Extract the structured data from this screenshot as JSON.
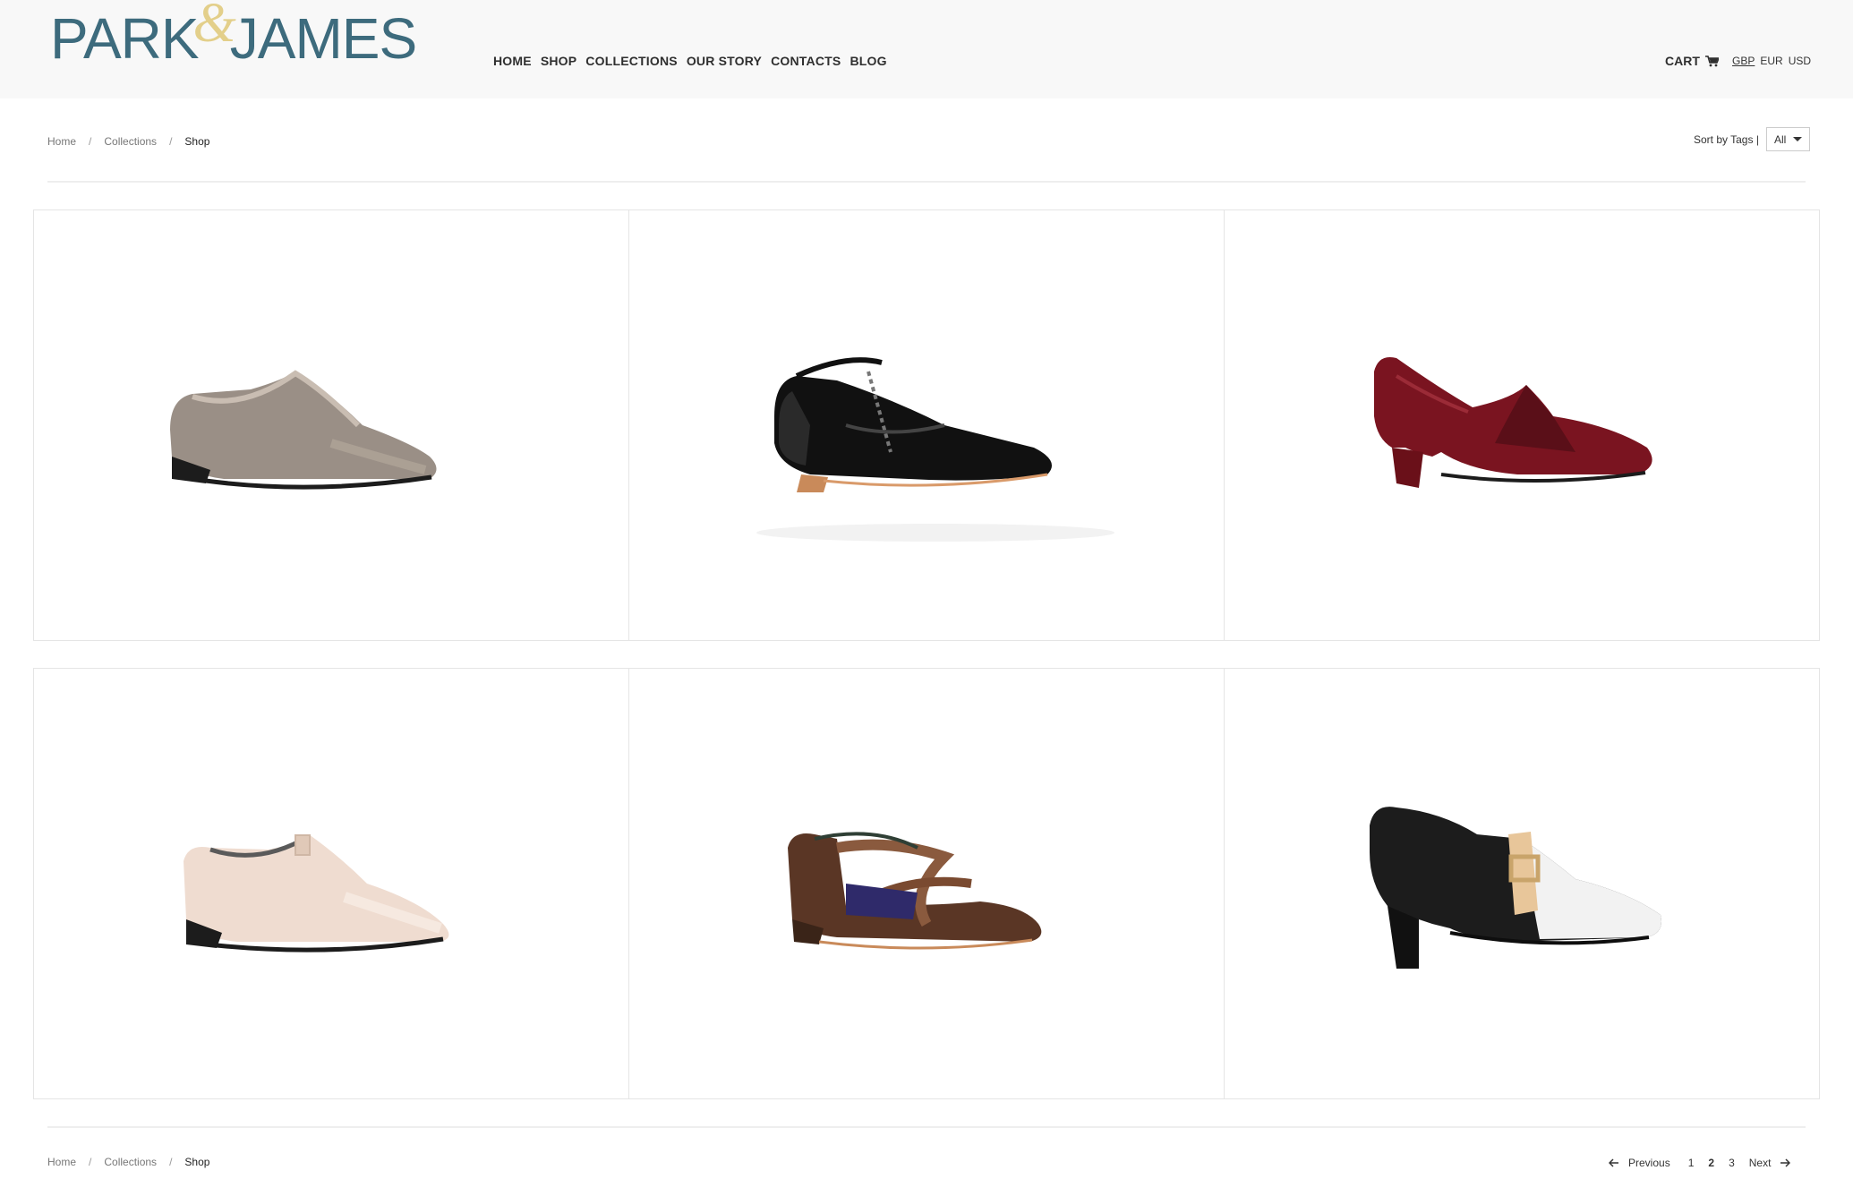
{
  "brand": {
    "left": "PARK",
    "amp": "&",
    "right": "JAMES"
  },
  "nav": [
    "HOME",
    "SHOP",
    "COLLECTIONS",
    "OUR STORY",
    "CONTACTS",
    "BLOG"
  ],
  "cart_label": "CART",
  "currencies": [
    "GBP",
    "EUR",
    "USD"
  ],
  "breadcrumb": {
    "home": "Home",
    "collections": "Collections",
    "current": "Shop",
    "separator": "/"
  },
  "sort": {
    "label": "Sort by Tags |",
    "value": "All"
  },
  "products": [
    {
      "name": "metallic-oxford",
      "color": "#9a8f86",
      "accent": "#bfb3a8"
    },
    {
      "name": "black-t-bar",
      "color": "#111111",
      "accent": "#444444"
    },
    {
      "name": "burgundy-heel-loafer",
      "color": "#7a1420",
      "accent": "#a32a36"
    },
    {
      "name": "nude-oxford",
      "color": "#efdcd0",
      "accent": "#f8ece3"
    },
    {
      "name": "bronze-cross-strap",
      "color": "#5a3625",
      "accent": "#8a5a3e"
    },
    {
      "name": "black-white-buckle-heel",
      "color": "#1c1c1c",
      "accent": "#f2f2f2"
    }
  ],
  "pagination": {
    "previous": "Previous",
    "pages": [
      "1",
      "2",
      "3"
    ],
    "current": "2",
    "next": "Next"
  },
  "colors": {
    "brand": "#3d6b7d",
    "brand_accent": "#e3cf8a",
    "header_bg": "#f8f8f8",
    "border": "#e5e5e5"
  }
}
